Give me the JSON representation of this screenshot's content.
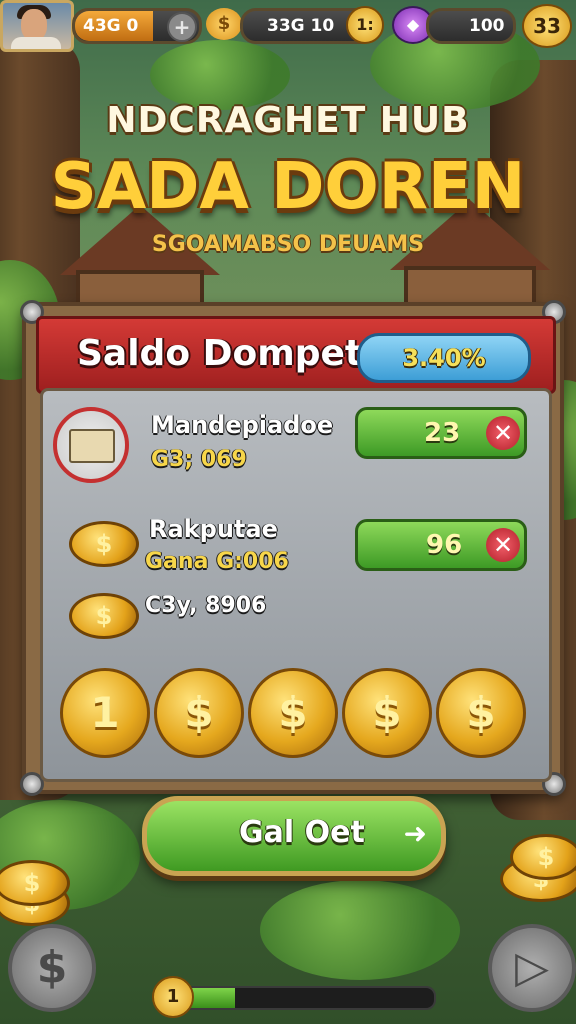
{
  "topbar": {
    "stat1": {
      "value": "43G 0",
      "icon": "plus-icon",
      "fill_pct": 63
    },
    "stat2": {
      "value": "33G 10",
      "icon": "coins-icon",
      "badge": "1:"
    },
    "stat3": {
      "value": "100",
      "icon": "gem-icon"
    },
    "currency_badge": "33"
  },
  "title": {
    "line1": "NDCRAGHET HUB",
    "line2": "SADA DOREN",
    "line3": "SGOAMABSO DEUAMS"
  },
  "panel": {
    "header_title": "Saldo Dompet",
    "balance": "3.40%",
    "rows": [
      {
        "name": "Mandepiadoe",
        "sub": "G3; 069",
        "value": "23",
        "icon": "treasure-map-icon"
      },
      {
        "name": "Rakputae",
        "sub": "Gana G:006",
        "value": "96",
        "icon": "coin-icon"
      },
      {
        "name": "",
        "sub": "C3y, 8906",
        "value": "",
        "icon": "coin-icon"
      }
    ],
    "coins": [
      "1",
      "$",
      "$",
      "$",
      "$"
    ]
  },
  "cta": {
    "label": "Gal Oet",
    "icon": "arrow-right-icon"
  },
  "bottom": {
    "left_icon": "dollar-icon",
    "right_icon": "play-icon",
    "progress_badge": "1",
    "progress_pct": 24
  },
  "colors": {
    "gold": "#ffcf3a",
    "header_red": "#c42e2a",
    "green": "#5cb83a"
  }
}
